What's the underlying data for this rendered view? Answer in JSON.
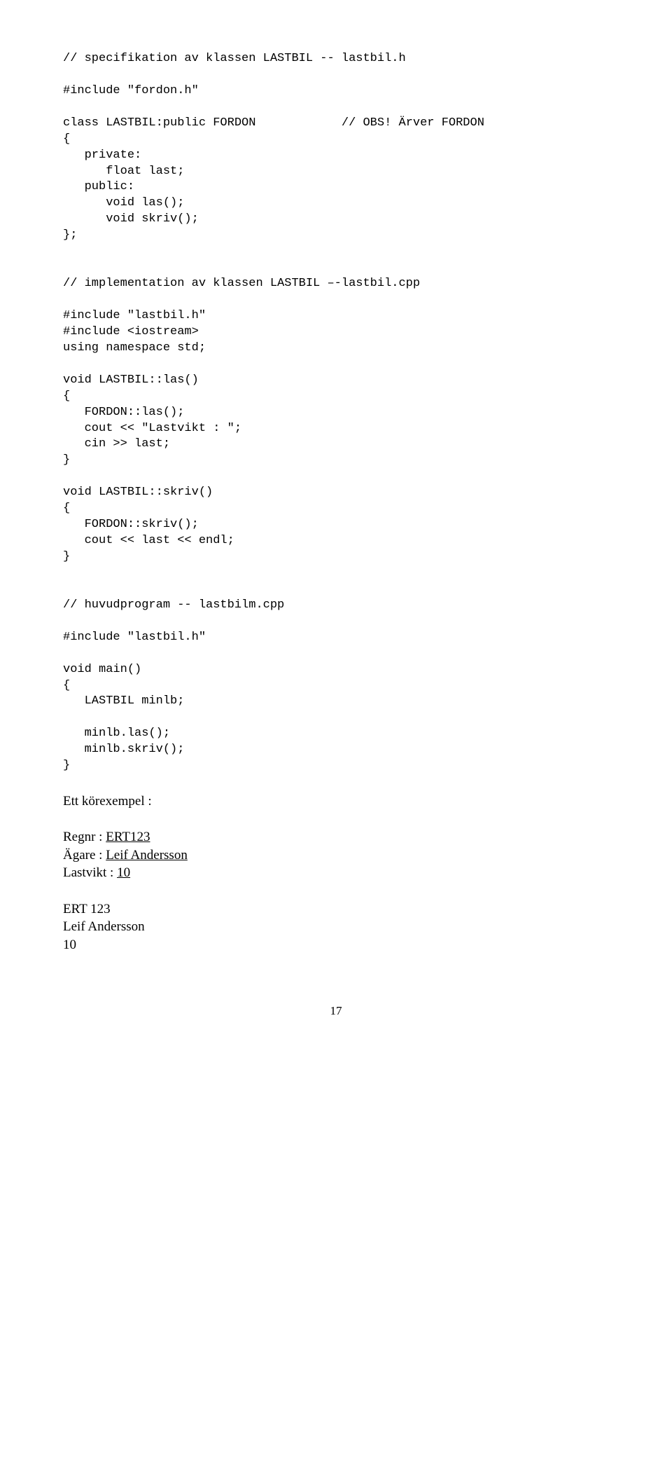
{
  "c1": "// specifikation av klassen LASTBIL -- lastbil.h",
  "c2": "#include \"fordon.h\"",
  "c3a": "class LASTBIL:public FORDON",
  "c3b": "            // OBS! Ärver FORDON",
  "c4": "{",
  "c5": "   private:",
  "c6": "      float last;",
  "c7": "   public:",
  "c8": "      void las();",
  "c9": "      void skriv();",
  "c10": "};",
  "c11": "// implementation av klassen LASTBIL –-lastbil.cpp",
  "c12": "#include \"lastbil.h\"",
  "c13": "#include <iostream>",
  "c14": "using namespace std;",
  "c15": "void LASTBIL::las()",
  "c16": "{",
  "c17": "   FORDON::las();",
  "c18": "   cout << \"Lastvikt : \";",
  "c19": "   cin >> last;",
  "c20": "}",
  "c21": "void LASTBIL::skriv()",
  "c22": "{",
  "c23": "   FORDON::skriv();",
  "c24": "   cout << last << endl;",
  "c25": "}",
  "c26": "// huvudprogram -- lastbilm.cpp",
  "c27": "#include \"lastbil.h\"",
  "c28": "void main()",
  "c29": "{",
  "c30": "   LASTBIL minlb;",
  "c31": "   minlb.las();",
  "c32": "   minlb.skriv();",
  "c33": "}",
  "s1": "Ett körexempel :",
  "s2a": "Regnr : ",
  "s2b": "ERT123",
  "s3a": "Ägare : ",
  "s3b": "Leif Andersson",
  "s4a": "Lastvikt : ",
  "s4b": "10",
  "s5": "ERT 123",
  "s6": "Leif Andersson",
  "s7": "10",
  "page": "17"
}
